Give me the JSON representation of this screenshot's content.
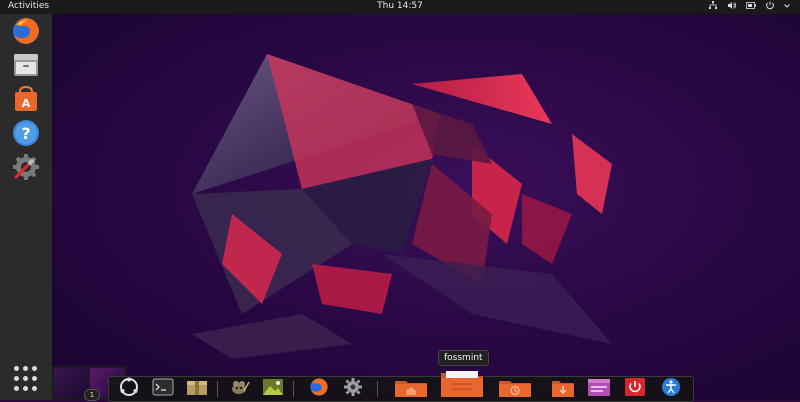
{
  "topbar": {
    "activities_label": "Activities",
    "clock": "Thu 14:57"
  },
  "dock": {
    "items": [
      {
        "name": "firefox",
        "icon": "firefox-icon"
      },
      {
        "name": "files",
        "icon": "file-cabinet-icon"
      },
      {
        "name": "software",
        "icon": "software-store-icon"
      },
      {
        "name": "help",
        "icon": "help-icon"
      },
      {
        "name": "settings",
        "icon": "settings-tools-icon"
      }
    ],
    "show_apps_icon": "apps-grid-icon"
  },
  "workspace": {
    "badge": "1"
  },
  "bottom_dock": {
    "tooltip": "fossmint",
    "items": [
      "ubuntu-logo-icon",
      "terminal-icon",
      "archive-icon",
      "gimp-icon",
      "image-viewer-icon",
      "firefox-icon",
      "settings-gear-icon",
      "home-folder-icon",
      "files-folder-icon",
      "recent-folder-icon",
      "downloads-folder-icon",
      "window-icon",
      "power-icon",
      "accessibility-icon"
    ]
  },
  "colors": {
    "topbar": "#1a1a1a",
    "dock": "#2b2b2b",
    "wallpaper_base": "#2a0845",
    "wallpaper_accent": "#e0254a",
    "folder_orange": "#e9672f"
  }
}
